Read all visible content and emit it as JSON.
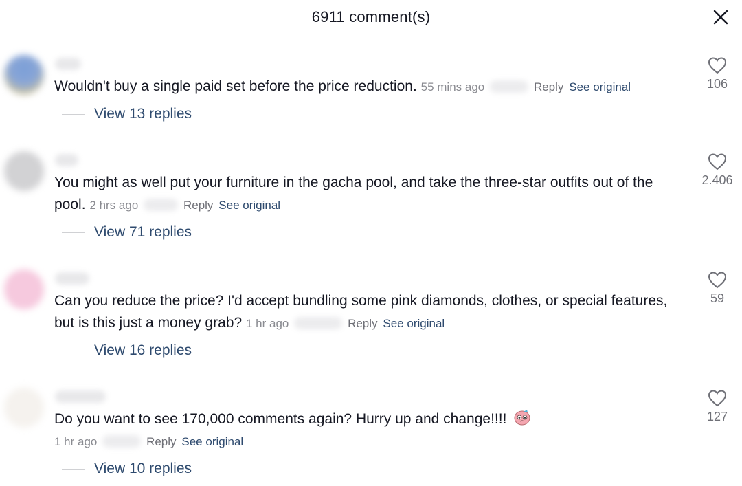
{
  "header": {
    "title": "6911 comment(s)"
  },
  "comments": [
    {
      "text": "Wouldn't buy a single paid set before the price reduction.",
      "time": "55 mins ago",
      "reply": "Reply",
      "see_original": "See original",
      "likes": "106",
      "replies_label": "View 13 replies"
    },
    {
      "text": "You might as well put your furniture in the gacha pool, and take the three-star outfits out of the pool.",
      "time": "2 hrs ago",
      "reply": "Reply",
      "see_original": "See original",
      "likes": "2.406",
      "replies_label": "View 71 replies"
    },
    {
      "text": "Can you reduce the price? I'd accept bundling some pink diamonds, clothes, or special features, but is this just a money grab?",
      "time": "1 hr ago",
      "reply": "Reply",
      "see_original": "See original",
      "likes": "59",
      "replies_label": "View 16 replies"
    },
    {
      "text": "Do you want to see 170,000 comments again? Hurry up and change!!!!",
      "time": "1 hr ago",
      "reply": "Reply",
      "see_original": "See original",
      "likes": "127",
      "replies_label": "View 10 replies"
    }
  ],
  "icons": {
    "close": "close-icon",
    "like": "heart-outline-icon",
    "emoji": "pleading-face-emoji"
  }
}
